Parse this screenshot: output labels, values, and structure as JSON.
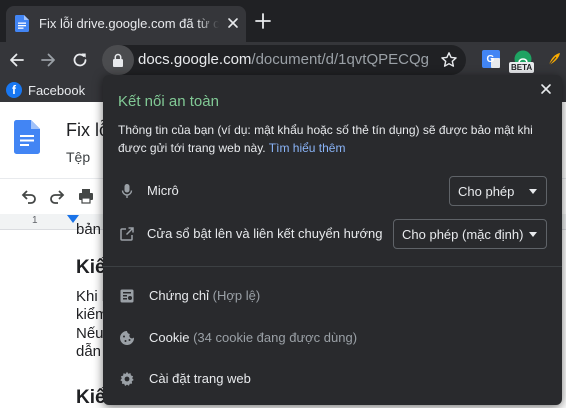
{
  "browser": {
    "tab": {
      "title": "Fix lỗi drive.google.com đã từ chối kết nối",
      "favicon": "google-docs-icon"
    },
    "url": {
      "host": "docs.google.com",
      "path": "/document/d/1qvtQPECQg..."
    },
    "extensions": [
      "google-translate-icon",
      "beta-extension-icon",
      "feather-extension-icon"
    ],
    "extension_badge": "BETA",
    "bookmarks": [
      {
        "label": "Facebook",
        "icon": "facebook-icon"
      }
    ]
  },
  "docs": {
    "title": "Fix lỗ",
    "menu_first": "Tệp",
    "ruler_number": "1",
    "body": {
      "line1": "bản",
      "heading1": "Kiể",
      "line2": "Khi b",
      "line3": "kiểm",
      "line4": "Nếu",
      "line5": "dẫn",
      "heading2": "Kiể"
    }
  },
  "popup": {
    "title": "Kết nối an toàn",
    "description": "Thông tin của bạn (ví dụ: mật khẩu hoặc số thẻ tín dụng) sẽ được bảo mật khi được gửi tới trang web này.",
    "learn_more": "Tìm hiểu thêm",
    "permissions": [
      {
        "label": "Micrô",
        "value": "Cho phép",
        "icon": "microphone-icon"
      },
      {
        "label": "Cửa sổ bật lên và liên kết chuyển hướng",
        "value": "Cho phép (mặc định)",
        "icon": "popup-redirect-icon"
      }
    ],
    "info_items": [
      {
        "label": "Chứng chỉ",
        "sub": "(Hợp lệ)",
        "icon": "certificate-icon"
      },
      {
        "label": "Cookie",
        "sub": "(34 cookie đang được dùng)",
        "icon": "cookie-icon"
      },
      {
        "label": "Cài đặt trang web",
        "sub": "",
        "icon": "settings-gear-icon"
      }
    ]
  },
  "colors": {
    "secure_green": "#81c995",
    "link_blue": "#8ab4f8",
    "popup_bg": "#292a2d",
    "toolbar_bg": "#35363a",
    "tabstrip_bg": "#202124"
  }
}
